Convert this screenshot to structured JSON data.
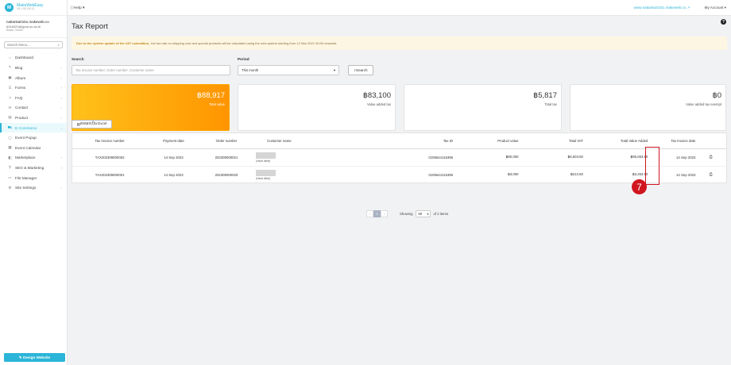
{
  "brand": {
    "name": "MakeWebEasy",
    "version": "V6.1.58 (36.0)"
  },
  "user": {
    "name": "nattanka0151.makeweb.co",
    "email": "6316023@gccb.su.ac.th",
    "plan": "Basic Owner"
  },
  "sidebar": {
    "search_placeholder": "Search Menu...",
    "items": [
      {
        "icon": "⌂",
        "label": "Dashboard",
        "chevron": ""
      },
      {
        "icon": "✎",
        "label": "Blog",
        "chevron": "›"
      },
      {
        "icon": "▣",
        "label": "Album",
        "chevron": "›"
      },
      {
        "icon": "☰",
        "label": "Forms",
        "chevron": "›"
      },
      {
        "icon": "?",
        "label": "FAQ",
        "chevron": "›"
      },
      {
        "icon": "✉",
        "label": "Contact",
        "chevron": "›"
      },
      {
        "icon": "▤",
        "label": "Product",
        "chevron": "›"
      },
      {
        "icon": "⛟",
        "label": "E-Commerce",
        "chevron": "›"
      },
      {
        "icon": "▢",
        "label": "Event Popup",
        "chevron": ""
      },
      {
        "icon": "▦",
        "label": "Event Calendar",
        "chevron": ""
      },
      {
        "icon": "◧",
        "label": "Marketplace",
        "chevron": "›"
      },
      {
        "icon": "⚲",
        "label": "SEO & Marketing",
        "chevron": "›"
      },
      {
        "icon": "▭",
        "label": "File Manager",
        "chevron": ""
      },
      {
        "icon": "⚙",
        "label": "Site Settings",
        "chevron": "›"
      }
    ],
    "design_button": "✎ Design Website"
  },
  "topbar": {
    "help": "Help",
    "site_link": "www.nattanka0151.makeweb.co",
    "account": "My Account"
  },
  "page": {
    "title": "Tax Report",
    "notice_bold": "Due to the system update of the VAT calculation,",
    "notice_text": "the tax rate on shipping cost and special products will be calculated using the new system starting from 12 Mar 2021 00:00 onwards",
    "search_label": "Search",
    "search_placeholder": "Tax invoice number, Order number, Customer name",
    "period_label": "Period",
    "period_value": "This month",
    "search_button": "Search",
    "export_button": "ส่งออกเป็น Excel"
  },
  "cards": [
    {
      "amount": "฿88,917",
      "caption": "Total value"
    },
    {
      "amount": "฿83,100",
      "caption": "Value added tax"
    },
    {
      "amount": "฿5,817",
      "caption": "Total tax"
    },
    {
      "amount": "฿0",
      "caption": "Value added tax exempt"
    }
  ],
  "table": {
    "headers": [
      "Tax Invoice number",
      "Payment date",
      "Order number",
      "Customer name",
      "Tax ID",
      "Product value",
      "Total VAT",
      "Total Value Added",
      "Tax Invoice date"
    ],
    "rows": [
      {
        "invoice": "TAX202309000002",
        "payment_date": "14 Sep 2023",
        "order": "202309000021",
        "office": "(Head office)",
        "tax_id": "0105544115396",
        "product_value": "฿80,050",
        "vat": "฿5,603.50",
        "total": "฿85,653.50",
        "invoice_date": "14 Sep 2023"
      },
      {
        "invoice": "TAX202309000001",
        "payment_date": "14 Sep 2023",
        "order": "202309000020",
        "office": "(Head office)",
        "tax_id": "0105544115396",
        "product_value": "฿3,050",
        "vat": "฿213.50",
        "total": "฿3,263.50",
        "invoice_date": "14 Sep 2023"
      }
    ]
  },
  "pagination": {
    "prev": "‹",
    "current": "1",
    "next": "›",
    "showing": "Showing",
    "per_page": "50",
    "of_items": "of 2 items"
  },
  "annotation": {
    "step": "7"
  }
}
